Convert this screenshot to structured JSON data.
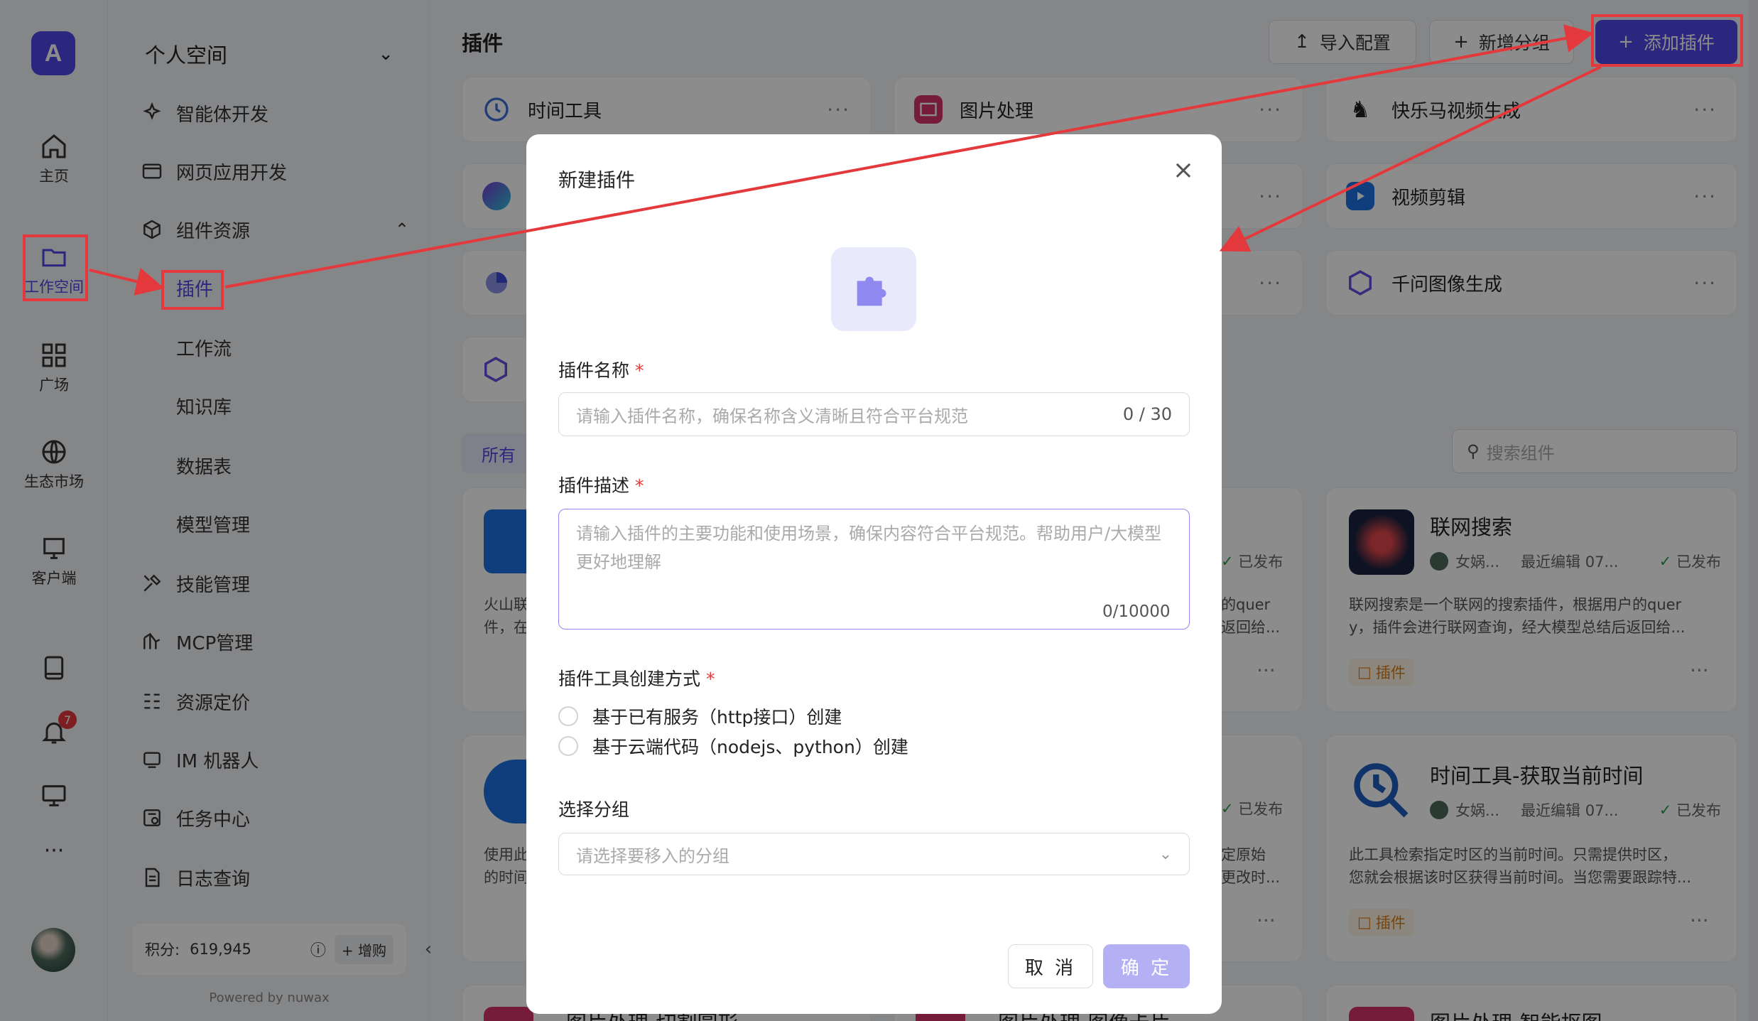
{
  "rail": {
    "logo_text": "A",
    "items": [
      {
        "label": "主页",
        "icon": "home-icon"
      },
      {
        "label": "工作空间",
        "icon": "folder-icon"
      },
      {
        "label": "广场",
        "icon": "grid-icon"
      },
      {
        "label": "生态市场",
        "icon": "globe-icon"
      },
      {
        "label": "客户端",
        "icon": "client-icon"
      }
    ],
    "notification_count": "7",
    "more_label": "···"
  },
  "sidebar": {
    "space_name": "个人空间",
    "menu": [
      {
        "label": "智能体开发",
        "icon": "agent-icon"
      },
      {
        "label": "网页应用开发",
        "icon": "webapp-icon"
      },
      {
        "label": "组件资源",
        "icon": "cube-icon"
      },
      {
        "label": "插件"
      },
      {
        "label": "工作流"
      },
      {
        "label": "知识库"
      },
      {
        "label": "数据表"
      },
      {
        "label": "模型管理"
      },
      {
        "label": "技能管理",
        "icon": "tools-icon"
      },
      {
        "label": "MCP管理",
        "icon": "mcp-icon"
      },
      {
        "label": "资源定价",
        "icon": "pricing-icon"
      },
      {
        "label": "IM 机器人",
        "icon": "robot-icon"
      },
      {
        "label": "任务中心",
        "icon": "task-icon"
      },
      {
        "label": "日志查询",
        "icon": "log-icon"
      }
    ],
    "points_label": "积分:",
    "points_value": "619,945",
    "buy_label": "+ 增购",
    "powered_by": "Powered by nuwax"
  },
  "header": {
    "title": "插件",
    "import_label": "导入配置",
    "new_group_label": "新增分组",
    "add_plugin_label": "添加插件"
  },
  "groups": [
    {
      "name": "时间工具"
    },
    {
      "name": "图片处理"
    },
    {
      "name": "快乐马视频生成"
    },
    {
      "name": "视频剪辑"
    },
    {
      "name": "千问图像生成"
    }
  ],
  "filter_chip": "所有",
  "search_placeholder": "搜索组件",
  "cards": [
    {
      "title": "联网搜索",
      "author": "女娲...",
      "edited": "最近编辑 07...",
      "status": "已发布",
      "desc1": "联网搜索是一个联网的搜索插件，根据用户的quer",
      "desc2": "y，插件会进行联网查询，经大模型总结后返回给...",
      "tag": "插件"
    },
    {
      "title": "时间工具-获取当前时间",
      "author": "女娲...",
      "edited": "最近编辑 07...",
      "status": "已发布",
      "desc1": "此工具检索指定时区的当前时间。只需提供时区，",
      "desc2": "您就会根据该时区获得当前时间。当您需要跟踪特...",
      "tag": "插件"
    }
  ],
  "partial_texts": {
    "left_desc_1a": "火山联",
    "left_desc_1b": "件，在",
    "left_desc_2a": "使用此",
    "left_desc_2b": "的时间",
    "mid_status": "已发布",
    "mid_desc_1a": "的quer",
    "mid_desc_1b": "返回给...",
    "mid_desc_2a": "定原始",
    "mid_desc_2b": "更改时...",
    "bottom_1": "图片处理-切割圆形",
    "bottom_2": "图片处理-图像卡片",
    "bottom_3": "图片处理-智能抠图"
  },
  "dialog": {
    "title": "新建插件",
    "name_label": "插件名称",
    "name_placeholder": "请输入插件名称，确保名称含义清晰且符合平台规范",
    "name_count": "0 / 30",
    "desc_label": "插件描述",
    "desc_placeholder": "请输入插件的主要功能和使用场景，确保内容符合平台规范。帮助用户/大模型更好地理解",
    "desc_count": "0/10000",
    "method_label": "插件工具创建方式",
    "method_options": [
      "基于已有服务（http接口）创建",
      "基于云端代码（nodejs、python）创建"
    ],
    "group_label": "选择分组",
    "group_placeholder": "请选择要移入的分组",
    "cancel_label": "取 消",
    "ok_label": "确 定",
    "required_mark": "*"
  },
  "colors": {
    "accent": "#5147e5",
    "annotation_red": "#e4393c",
    "overlay": "rgba(0,0,0,0.45)"
  }
}
